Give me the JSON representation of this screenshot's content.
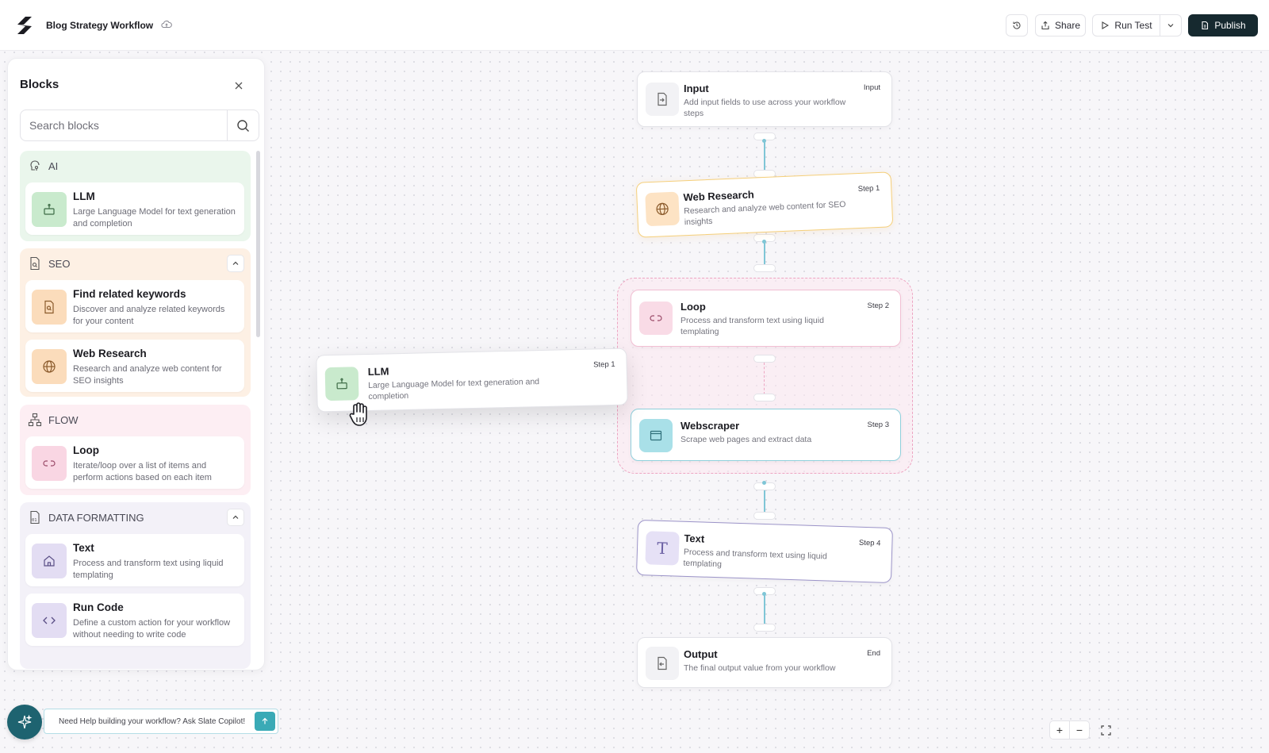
{
  "header": {
    "title": "Blog Strategy Workflow",
    "share_label": "Share",
    "run_test_label": "Run Test",
    "publish_label": "Publish"
  },
  "sidebar": {
    "title": "Blocks",
    "search_placeholder": "Search blocks",
    "categories": [
      {
        "label": "AI",
        "items": [
          {
            "title": "LLM",
            "desc": "Large Language Model for text generation and completion"
          }
        ]
      },
      {
        "label": "SEO",
        "items": [
          {
            "title": "Find related keywords",
            "desc": "Discover and analyze related keywords for your content"
          },
          {
            "title": "Web Research",
            "desc": "Research and analyze web content for SEO insights"
          }
        ]
      },
      {
        "label": "FLOW",
        "items": [
          {
            "title": "Loop",
            "desc": "Iterate/loop over a list of items and perform actions based on each item"
          }
        ]
      },
      {
        "label": "DATA FORMATTING",
        "items": [
          {
            "title": "Text",
            "desc": "Process and transform text using liquid templating"
          },
          {
            "title": "Run Code",
            "desc": "Define a custom action for your workflow without needing to write code"
          }
        ]
      }
    ]
  },
  "canvas": {
    "nodes": {
      "input": {
        "title": "Input",
        "desc": "Add input fields to use across your workflow steps",
        "step": "Input"
      },
      "web_research": {
        "title": "Web Research",
        "desc": "Research and analyze web content for SEO insights",
        "step": "Step 1"
      },
      "loop": {
        "title": "Loop",
        "desc": "Process and transform text using liquid templating",
        "step": "Step 2"
      },
      "webscraper": {
        "title": "Webscraper",
        "desc": "Scrape web pages and extract data",
        "step": "Step 3"
      },
      "text": {
        "title": "Text",
        "desc": "Process and transform text using liquid templating",
        "step": "Step 4"
      },
      "output": {
        "title": "Output",
        "desc": "The final output value from your workflow",
        "step": "End"
      }
    },
    "dragging": {
      "title": "LLM",
      "desc": "Large Language Model for text generation and completion",
      "step": "Step 1"
    },
    "zoom": {
      "in": "+",
      "out": "−"
    }
  },
  "copilot": {
    "text": "Need Help building your workflow? Ask Slate Copilot!"
  },
  "colors": {
    "accent": "#16292f",
    "connector": "#7fc6d6",
    "ai_bg": "#eaf6ec",
    "seo_bg": "#fdf0e4",
    "flow_bg": "#fdeef3",
    "data_bg": "#f3f1f8"
  }
}
